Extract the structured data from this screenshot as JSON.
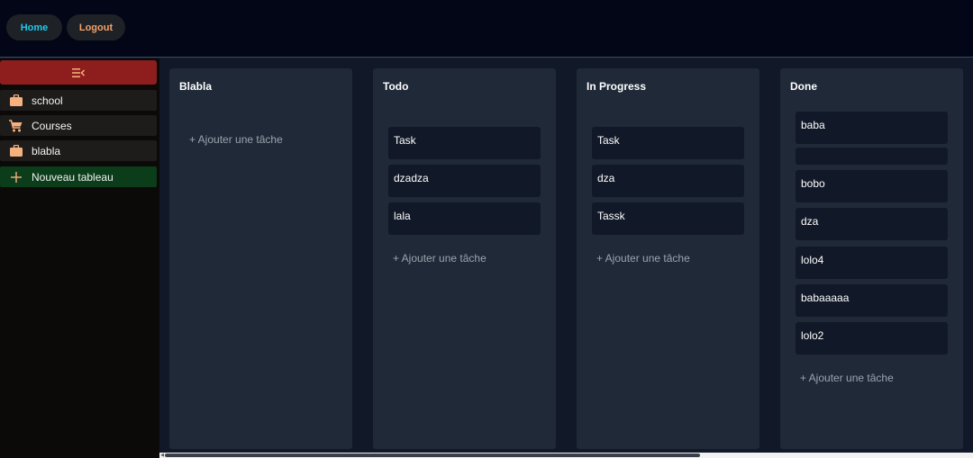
{
  "header": {
    "home_label": "Home",
    "logout_label": "Logout"
  },
  "sidebar": {
    "items": [
      {
        "label": "school",
        "icon": "briefcase-icon"
      },
      {
        "label": "Courses",
        "icon": "cart-icon"
      },
      {
        "label": "blabla",
        "icon": "briefcase-icon"
      },
      {
        "label": "Nouveau tableau",
        "icon": "plus-icon"
      }
    ]
  },
  "columns": [
    {
      "title": "Blabla",
      "cards": []
    },
    {
      "title": "Todo",
      "cards": [
        "Task",
        "dzadza",
        "lala"
      ]
    },
    {
      "title": "In Progress",
      "cards": [
        "Task",
        "dza",
        "Tassk"
      ]
    },
    {
      "title": "Done",
      "cards": [
        "baba",
        "",
        "bobo",
        "dza",
        "lolo4",
        "babaaaaa",
        "lolo2"
      ]
    }
  ],
  "add_task_label": "+ Ajouter une tâche",
  "colors": {
    "header_bg": "#030616",
    "toggle_bg": "#8e1e1e",
    "new_board_bg": "#0b3d1a",
    "column_bg": "#1f2937",
    "card_bg": "#111827",
    "home_text": "#22c7e8",
    "logout_text": "#f3a26b",
    "icon_color": "#f6b27e"
  }
}
